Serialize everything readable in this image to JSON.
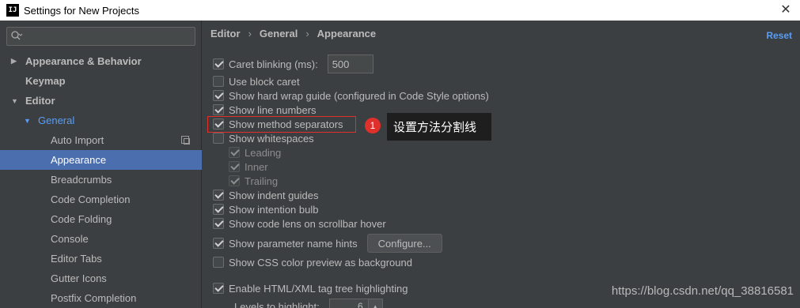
{
  "window": {
    "title": "Settings for New Projects",
    "app_icon": "IJ",
    "close_glyph": "✕"
  },
  "sidebar": {
    "search_placeholder": "",
    "items": [
      {
        "label": "Appearance & Behavior",
        "arrow": "▶"
      },
      {
        "label": "Keymap"
      },
      {
        "label": "Editor",
        "arrow": "▼"
      },
      {
        "label": "General",
        "arrow": "▼"
      },
      {
        "label": "Auto Import"
      },
      {
        "label": "Appearance"
      },
      {
        "label": "Breadcrumbs"
      },
      {
        "label": "Code Completion"
      },
      {
        "label": "Code Folding"
      },
      {
        "label": "Console"
      },
      {
        "label": "Editor Tabs"
      },
      {
        "label": "Gutter Icons"
      },
      {
        "label": "Postfix Completion"
      }
    ]
  },
  "breadcrumb": {
    "items": [
      "Editor",
      "General",
      "Appearance"
    ],
    "separator": "›"
  },
  "reset_label": "Reset",
  "options": {
    "caret_blinking": {
      "label": "Caret blinking (ms):",
      "value": "500",
      "checked": true
    },
    "block_caret": {
      "label": "Use block caret",
      "checked": false
    },
    "hard_wrap": {
      "label": "Show hard wrap guide (configured in Code Style options)",
      "checked": true
    },
    "line_numbers": {
      "label": "Show line numbers",
      "checked": true
    },
    "method_separators": {
      "label": "Show method separators",
      "checked": true
    },
    "whitespaces": {
      "label": "Show whitespaces",
      "checked": false
    },
    "leading": {
      "label": "Leading",
      "checked": true
    },
    "inner": {
      "label": "Inner",
      "checked": true
    },
    "trailing": {
      "label": "Trailing",
      "checked": true
    },
    "indent_guides": {
      "label": "Show indent guides",
      "checked": true
    },
    "intention_bulb": {
      "label": "Show intention bulb",
      "checked": true
    },
    "code_lens": {
      "label": "Show code lens on scrollbar hover",
      "checked": true
    },
    "param_hints": {
      "label": "Show parameter name hints",
      "checked": true,
      "button": "Configure..."
    },
    "css_color": {
      "label": "Show CSS color preview as background",
      "checked": false
    },
    "html_tag_tree": {
      "label": "Enable HTML/XML tag tree highlighting",
      "checked": true
    },
    "levels": {
      "label": "Levels to highlight:",
      "value": "6"
    }
  },
  "annotation": {
    "number": "1",
    "text": "设置方法分割线",
    "color": "#e0302c"
  },
  "watermark": "https://blog.csdn.net/qq_38816581"
}
